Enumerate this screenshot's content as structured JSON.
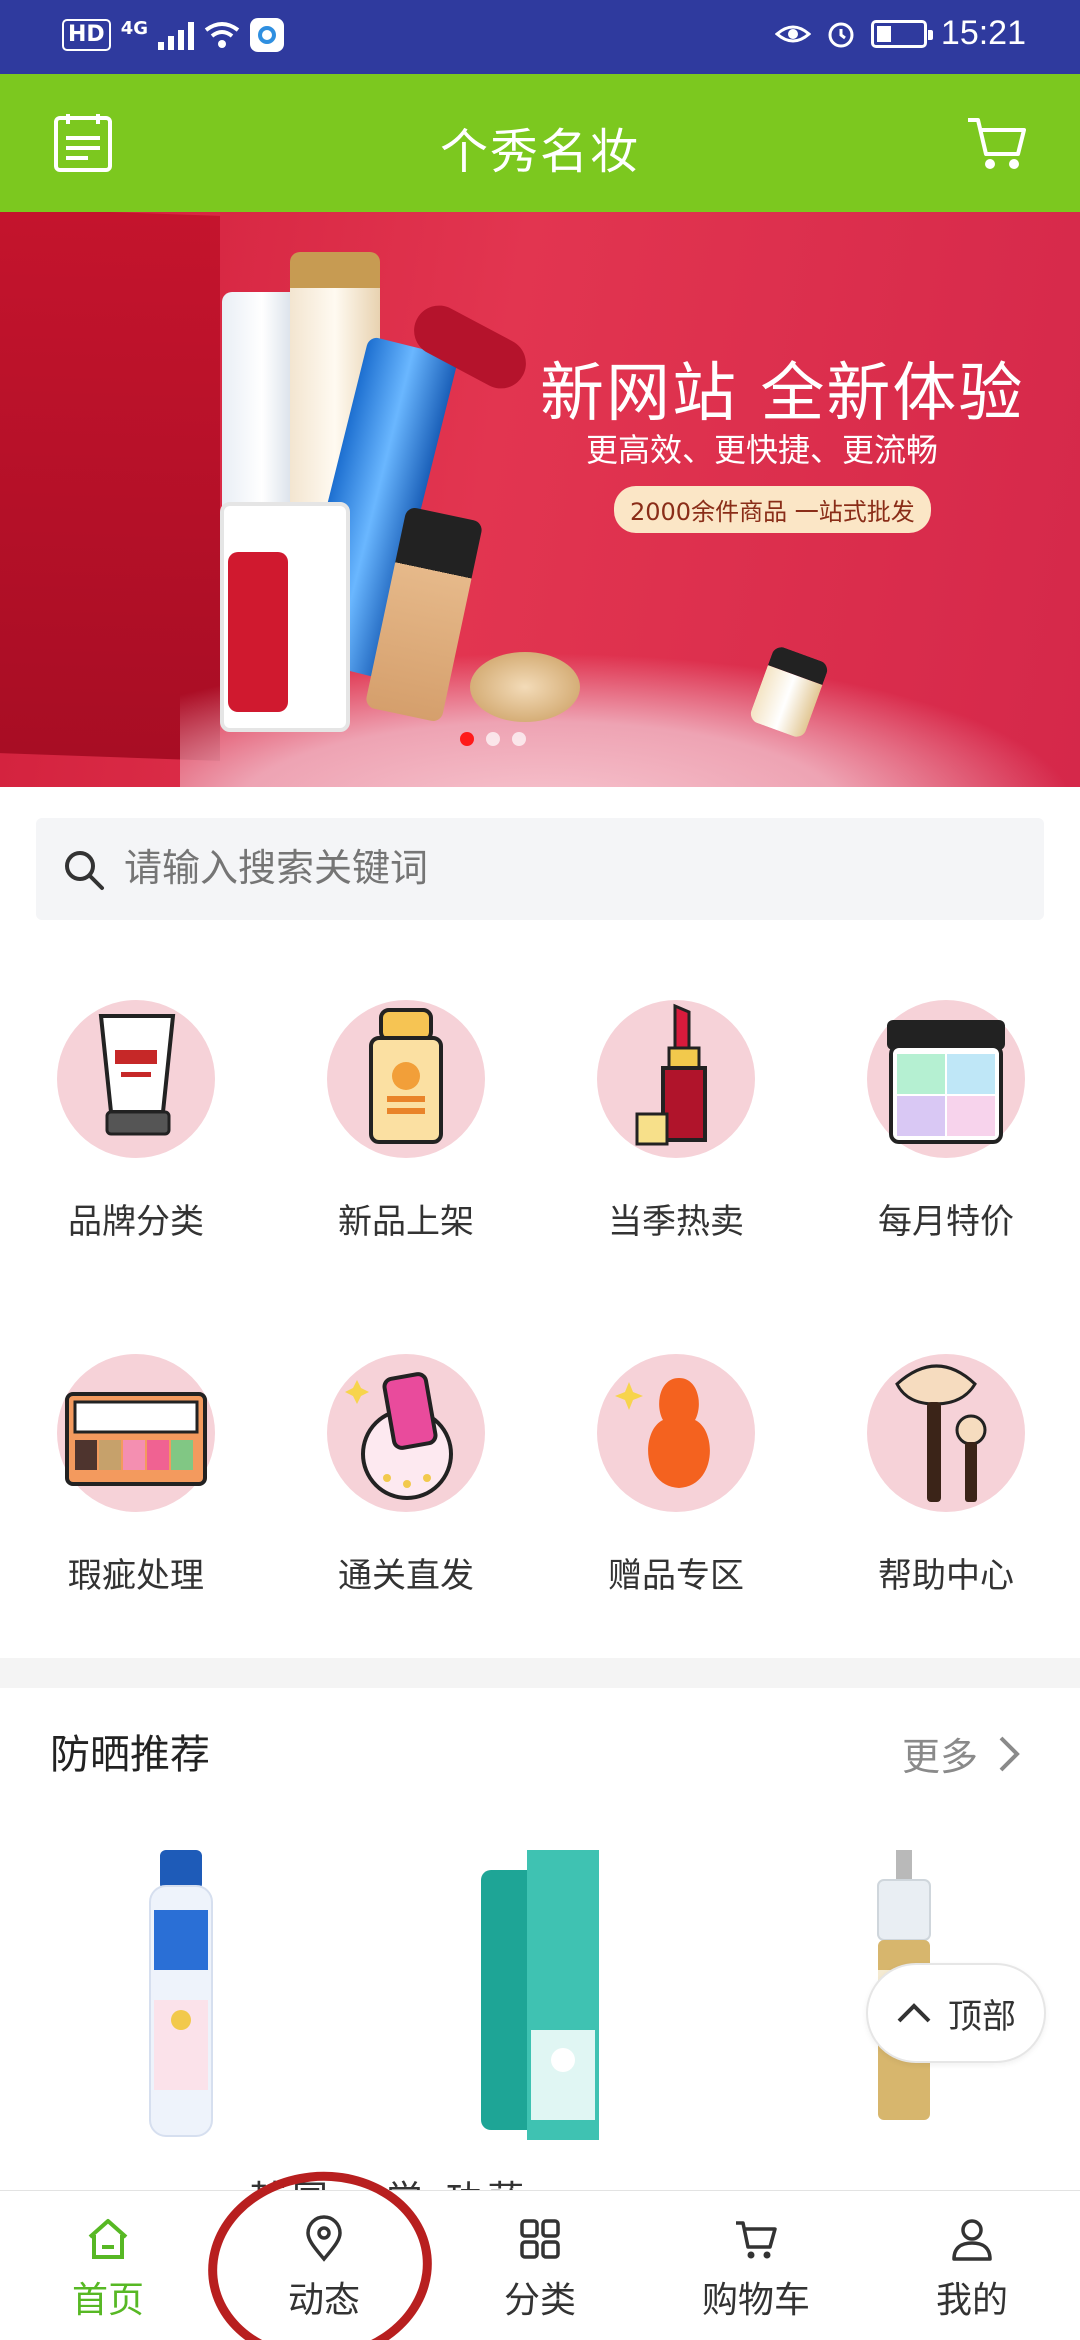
{
  "status_bar": {
    "hd": "HD",
    "network": "4G",
    "time": "15:21",
    "icons": [
      "signal-icon",
      "wifi-icon",
      "app-icon",
      "eye-icon",
      "alarm-icon",
      "battery-icon"
    ]
  },
  "header": {
    "title": "个秀名妆",
    "left_icon": "list-icon",
    "right_icon": "cart-icon"
  },
  "banner": {
    "headline": "新网站  全新体验",
    "subline": "更高效、更快捷、更流畅",
    "pill": "2000余件商品 一站式批发",
    "dot_count": 3,
    "active_dot": 0
  },
  "search": {
    "placeholder": "请输入搜索关键词"
  },
  "categories": [
    {
      "label": "品牌分类",
      "icon": "tube-icon"
    },
    {
      "label": "新品上架",
      "icon": "sunscreen-icon"
    },
    {
      "label": "当季热卖",
      "icon": "lipstick-icon"
    },
    {
      "label": "每月特价",
      "icon": "palette-icon"
    },
    {
      "label": "瑕疵处理",
      "icon": "eyeshadow-icon"
    },
    {
      "label": "通关直发",
      "icon": "phone-icon"
    },
    {
      "label": "赠品专区",
      "icon": "sponge-icon"
    },
    {
      "label": "帮助中心",
      "icon": "brush-icon"
    }
  ],
  "recommend": {
    "title": "防晒推荐",
    "more": "更多",
    "partial_text": "韩国    ‧    学   功萨"
  },
  "back_to_top": "顶部",
  "tabbar": [
    {
      "label": "首页",
      "icon": "home-icon",
      "active": true
    },
    {
      "label": "动态",
      "icon": "location-icon",
      "active": false
    },
    {
      "label": "分类",
      "icon": "grid-icon",
      "active": false
    },
    {
      "label": "购物车",
      "icon": "cart-icon",
      "active": false
    },
    {
      "label": "我的",
      "icon": "user-icon",
      "active": false
    }
  ],
  "colors": {
    "status_bar": "#2f3a9e",
    "header": "#7cc81f",
    "active_tab": "#57b824",
    "annotation_ring": "#b81f1f"
  }
}
